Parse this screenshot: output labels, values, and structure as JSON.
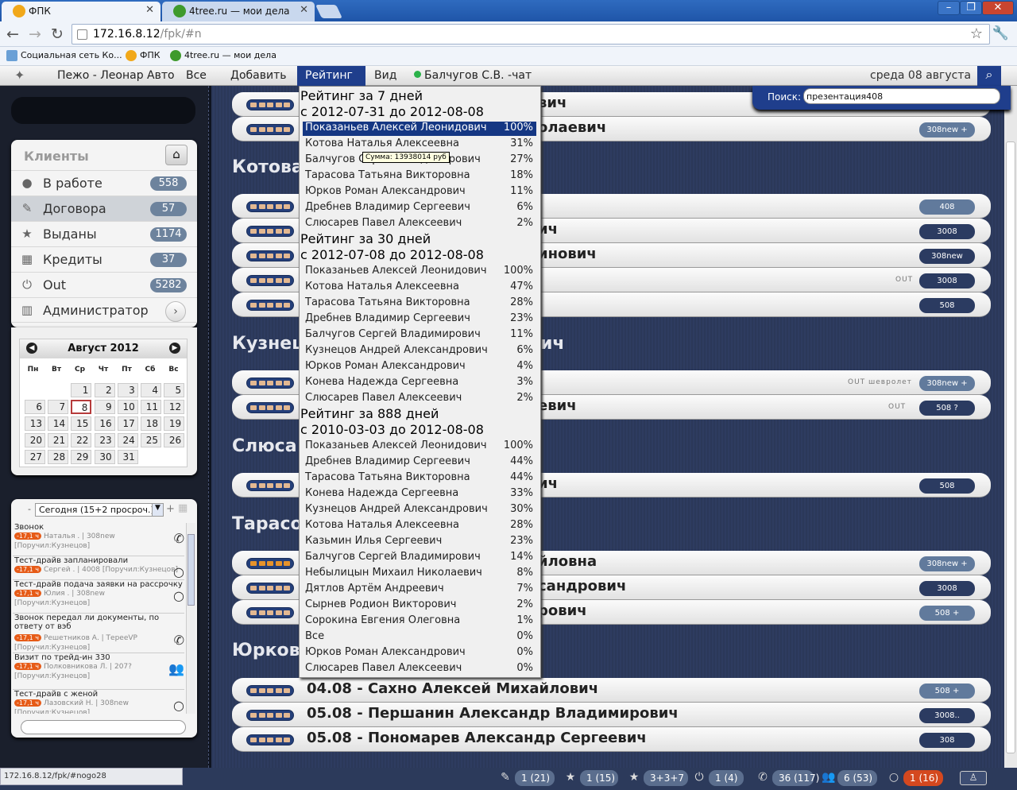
{
  "browser": {
    "tabs": [
      {
        "label": "ФПК"
      },
      {
        "label": "4tree.ru — мои дела"
      }
    ],
    "url_host": "172.16.8.12",
    "url_path": "/fpk/#n",
    "bookmarks": [
      {
        "label": "Социальная сеть Ко..."
      },
      {
        "label": "ФПК"
      },
      {
        "label": "4tree.ru — мои дела"
      }
    ]
  },
  "appbar": {
    "brand": "Пежо - Леонар Авто",
    "menu": [
      "Все",
      "Добавить",
      "Рейтинг",
      "Вид"
    ],
    "chat": "Балчугов С.В. -чат",
    "date": "среда 08 августа"
  },
  "search": {
    "label": "Поиск:",
    "value": "презентация408"
  },
  "clients": {
    "title": "Клиенты",
    "items": [
      {
        "label": "В работе",
        "count": "558"
      },
      {
        "label": "Договора",
        "count": "57"
      },
      {
        "label": "Выданы",
        "count": "1174"
      },
      {
        "label": "Кредиты",
        "count": "37"
      },
      {
        "label": "Out",
        "count": "5282"
      },
      {
        "label": "Администратор"
      }
    ]
  },
  "calendar": {
    "month": "Август 2012",
    "weekdays": [
      "Пн",
      "Вт",
      "Ср",
      "Чт",
      "Пт",
      "Сб",
      "Вс"
    ],
    "days": [
      "1",
      "2",
      "3",
      "4",
      "5",
      "6",
      "7",
      "8",
      "9",
      "10",
      "11",
      "12",
      "13",
      "14",
      "15",
      "16",
      "17",
      "18",
      "19",
      "20",
      "21",
      "22",
      "23",
      "24",
      "25",
      "26",
      "27",
      "28",
      "29",
      "30",
      "31"
    ]
  },
  "tasks": {
    "filter": "Сегодня (15+2 просроч.)",
    "items": [
      {
        "title": "Звонок",
        "overdue": "-17,1 ч",
        "meta": "Наталья . | 308new",
        "meta2": "[Поручил:Кузнецов]"
      },
      {
        "title": "Тест-драйв запланировали",
        "overdue": "-17,1 ч",
        "meta": "Сергей . | 4008 [Поручил:Кузнецов]",
        "meta2": ""
      },
      {
        "title": "Тест-драйв подача заявки на рассрочку",
        "overdue": "-17,1 ч",
        "meta": "Юлия . | 308new",
        "meta2": "[Поручил:Кузнецов]"
      },
      {
        "title": "Звонок передал ли документы, по ответу от вэб",
        "overdue": "-17,1 ч",
        "meta": "Решетников А. | ТереeVP",
        "meta2": "[Поручил:Кузнецов]"
      },
      {
        "title": "Визит по трейд-ин 330",
        "overdue": "-17,1 ч",
        "meta": "Полковникова Л. | 207?",
        "meta2": "[Поручил:Кузнецов]"
      },
      {
        "title": "Тест-драйв с женой",
        "overdue": "-17,1 ч",
        "meta": "Лазовский Н. | 308new",
        "meta2": "[Поручил:Кузнецов]"
      }
    ]
  },
  "content": {
    "groups": [
      "Котова",
      "Кузнец",
      "Слюса",
      "Тарасо",
      "Юрков"
    ],
    "cards": [
      {
        "name": "вич",
        "badge": "",
        "tag": ""
      },
      {
        "name": "олаевич",
        "badge": "308new +",
        "tag": ""
      },
      {
        "name": "",
        "badge": "408",
        "tag": ""
      },
      {
        "name": "ич",
        "badge": "3008",
        "tag": ""
      },
      {
        "name": "инович",
        "badge": "308new",
        "tag": ""
      },
      {
        "name": "",
        "badge": "3008",
        "tag": "OUT"
      },
      {
        "name": "",
        "badge": "508",
        "tag": ""
      },
      {
        "name": "",
        "badge": "308new +",
        "tag": "OUT шевролет"
      },
      {
        "name": "евич",
        "badge": "508 ?",
        "tag": "OUT"
      },
      {
        "name": "ич",
        "badge": "508",
        "tag": ""
      },
      {
        "name": "йловна",
        "badge": "308new +",
        "tag": ""
      },
      {
        "name": "сандрович",
        "badge": "3008",
        "tag": ""
      },
      {
        "name": "рович",
        "badge": "508 +",
        "tag": ""
      },
      {
        "name": "04.08 - Сахно Алексей Михайлович",
        "badge": "508 +",
        "tag": ""
      },
      {
        "name": "05.08 - Першанин Александр Владимирович",
        "badge": "3008..",
        "tag": ""
      },
      {
        "name": "05.08 - Пономарев Александр Сергеевич",
        "badge": "308",
        "tag": ""
      }
    ],
    "group_suffix": "ич"
  },
  "rating": {
    "sections": [
      {
        "title": "Рейтинг за 7 дней",
        "range": "с 2012-07-31 до 2012-08-08",
        "rows": [
          {
            "name": "Показаньев Алексей Леонидович",
            "pct": "100%"
          },
          {
            "name": "Котова Наталья Алексеевна",
            "pct": "31%"
          },
          {
            "name": "Балчугов Сергей Владимирович",
            "pct": "27%"
          },
          {
            "name": "Тарасова Татьяна Викторовна",
            "pct": "18%"
          },
          {
            "name": "Юрков Роман Александрович",
            "pct": "11%"
          },
          {
            "name": "Дребнев Владимир Сергеевич",
            "pct": "6%"
          },
          {
            "name": "Слюсарев Павел Алексеевич",
            "pct": "2%"
          }
        ]
      },
      {
        "title": "Рейтинг за 30 дней",
        "range": "с 2012-07-08 до 2012-08-08",
        "rows": [
          {
            "name": "Показаньев Алексей Леонидович",
            "pct": "100%"
          },
          {
            "name": "Котова Наталья Алексеевна",
            "pct": "47%"
          },
          {
            "name": "Тарасова Татьяна Викторовна",
            "pct": "28%"
          },
          {
            "name": "Дребнев Владимир Сергеевич",
            "pct": "23%"
          },
          {
            "name": "Балчугов Сергей Владимирович",
            "pct": "11%"
          },
          {
            "name": "Кузнецов Андрей Александрович",
            "pct": "6%"
          },
          {
            "name": "Юрков Роман Александрович",
            "pct": "4%"
          },
          {
            "name": "Конева Надежда Сергеевна",
            "pct": "3%"
          },
          {
            "name": "Слюсарев Павел Алексеевич",
            "pct": "2%"
          }
        ]
      },
      {
        "title": "Рейтинг за 888 дней",
        "range": "с 2010-03-03 до 2012-08-08",
        "rows": [
          {
            "name": "Показаньев Алексей Леонидович",
            "pct": "100%"
          },
          {
            "name": "Дребнев Владимир Сергеевич",
            "pct": "44%"
          },
          {
            "name": "Тарасова Татьяна Викторовна",
            "pct": "44%"
          },
          {
            "name": "Конева Надежда Сергеевна",
            "pct": "33%"
          },
          {
            "name": "Кузнецов Андрей Александрович",
            "pct": "30%"
          },
          {
            "name": "Котова Наталья Алексеевна",
            "pct": "28%"
          },
          {
            "name": "Казьмин Илья Сергеевич",
            "pct": "23%"
          },
          {
            "name": "Балчугов Сергей Владимирович",
            "pct": "14%"
          },
          {
            "name": "Небылицын Михаил Николаевич",
            "pct": "8%"
          },
          {
            "name": "Дятлов Артём Андреевич",
            "pct": "7%"
          },
          {
            "name": "Сырнев Родион Викторович",
            "pct": "2%"
          },
          {
            "name": "Сорокина Евгения Олеговна",
            "pct": "1%"
          },
          {
            "name": "Все",
            "pct": "0%"
          },
          {
            "name": "Юрков Роман Александрович",
            "pct": "0%"
          },
          {
            "name": "Слюсарев Павел Алексеевич",
            "pct": "0%"
          }
        ]
      }
    ],
    "tooltip": "Сумма: 13938014 руб"
  },
  "statusbar": {
    "url": "172.16.8.12/fpk/#nogo28",
    "counters": [
      {
        "icon": "edit-icon",
        "value": "1 (21)"
      },
      {
        "icon": "star-icon",
        "value": "1 (15)"
      },
      {
        "icon": "star-outline-icon",
        "value": "3+3+7"
      },
      {
        "icon": "power-icon",
        "value": "1 (4)"
      },
      {
        "icon": "phone-icon",
        "value": "36 (117)"
      },
      {
        "icon": "people-icon",
        "value": "6 (53)"
      },
      {
        "icon": "circle-icon",
        "value": "1 (16)"
      }
    ]
  }
}
